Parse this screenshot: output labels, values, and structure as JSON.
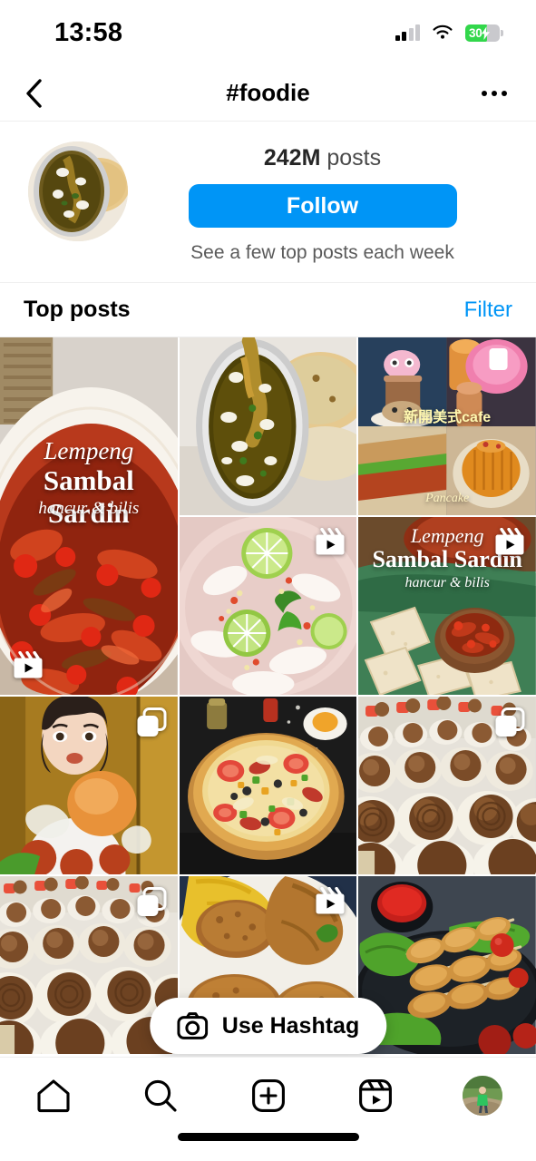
{
  "status_bar": {
    "time": "13:58",
    "battery_percent": "30",
    "icons": [
      "cellular-signal-icon",
      "wifi-icon",
      "battery-charging-icon"
    ]
  },
  "header": {
    "title": "#foodie",
    "back_icon": "chevron-left-icon",
    "more_icon": "more-options-icon"
  },
  "profile": {
    "avatar_alt": "hashtag-avatar",
    "posts_value": "242M",
    "posts_label": "posts",
    "follow_label": "Follow",
    "subtitle": "See a few top posts each week",
    "accent_color": "#0095f6"
  },
  "posts_section": {
    "title": "Top posts",
    "filter_label": "Filter"
  },
  "grid": {
    "cells": [
      {
        "id": "post-1",
        "type": "reel",
        "badge": "reels-icon",
        "badge_position": "bottom-left",
        "span": "tall",
        "caption_script": "Lempeng",
        "caption_main": "Sambal Sardin",
        "caption_sub": "hancur & bilis",
        "alt": "sambal-sardine-dish"
      },
      {
        "id": "post-2",
        "type": "photo",
        "badge": "none",
        "alt": "curry-with-flatbread"
      },
      {
        "id": "post-3",
        "type": "photo",
        "badge": "none",
        "alt": "cafe-dessert-collage",
        "caption_main": "新開美式cafe",
        "caption_sub": "Pancake"
      },
      {
        "id": "post-4",
        "type": "reel",
        "badge": "reels-icon",
        "alt": "squid-lime-soup"
      },
      {
        "id": "post-5",
        "type": "reel",
        "badge": "reels-icon",
        "caption_script": "Lempeng",
        "caption_main": "Sambal Sardin",
        "caption_sub": "hancur & bilis",
        "alt": "sambal-sardine-with-flatbread"
      },
      {
        "id": "post-6",
        "type": "carousel",
        "badge": "carousel-icon",
        "alt": "mukbang-creator"
      },
      {
        "id": "post-7",
        "type": "photo",
        "badge": "none",
        "alt": "supreme-pizza"
      },
      {
        "id": "post-8",
        "type": "carousel",
        "badge": "carousel-icon",
        "alt": "chocolate-cupcakes-tray"
      },
      {
        "id": "post-9",
        "type": "carousel",
        "badge": "carousel-icon",
        "alt": "chocolate-cupcakes-tray-2"
      },
      {
        "id": "post-10",
        "type": "reel",
        "badge": "reels-icon",
        "alt": "fried-cutlet-rice-platter"
      },
      {
        "id": "post-11",
        "type": "photo",
        "badge": "none",
        "alt": "skewers-with-sauce"
      }
    ]
  },
  "use_hashtag": {
    "label": "Use Hashtag",
    "icon": "camera-icon"
  },
  "tab_bar": {
    "items": [
      {
        "name": "home",
        "icon": "home-icon"
      },
      {
        "name": "search",
        "icon": "search-icon"
      },
      {
        "name": "create",
        "icon": "plus-square-icon"
      },
      {
        "name": "reels",
        "icon": "reels-icon"
      },
      {
        "name": "profile",
        "icon": "profile-avatar"
      }
    ]
  }
}
